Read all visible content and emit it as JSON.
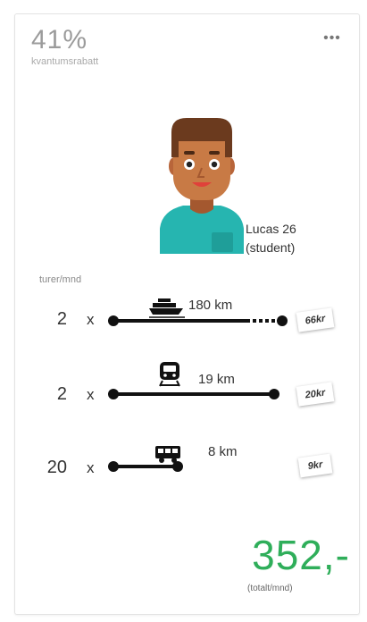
{
  "discount": {
    "percent": "41%",
    "label": "kvantumsrabatt"
  },
  "menu": {
    "icon": "more-dots-icon",
    "glyph": "•••"
  },
  "person": {
    "name": "Lucas 26",
    "note": "(student)"
  },
  "trips": {
    "label": "turer/mnd",
    "times_symbol": "x",
    "routes": [
      {
        "count": "2",
        "mode": "ferry-icon",
        "distance": "180 km",
        "price": "66kr"
      },
      {
        "count": "2",
        "mode": "train-icon",
        "distance": "19 km",
        "price": "20kr"
      },
      {
        "count": "20",
        "mode": "bus-icon",
        "distance": "8 km",
        "price": "9kr"
      }
    ]
  },
  "total": {
    "amount": "352,-",
    "label": "(totalt/mnd)"
  },
  "colors": {
    "total": "#2fae5a",
    "line": "#111111",
    "muted": "#9b9b9b"
  }
}
